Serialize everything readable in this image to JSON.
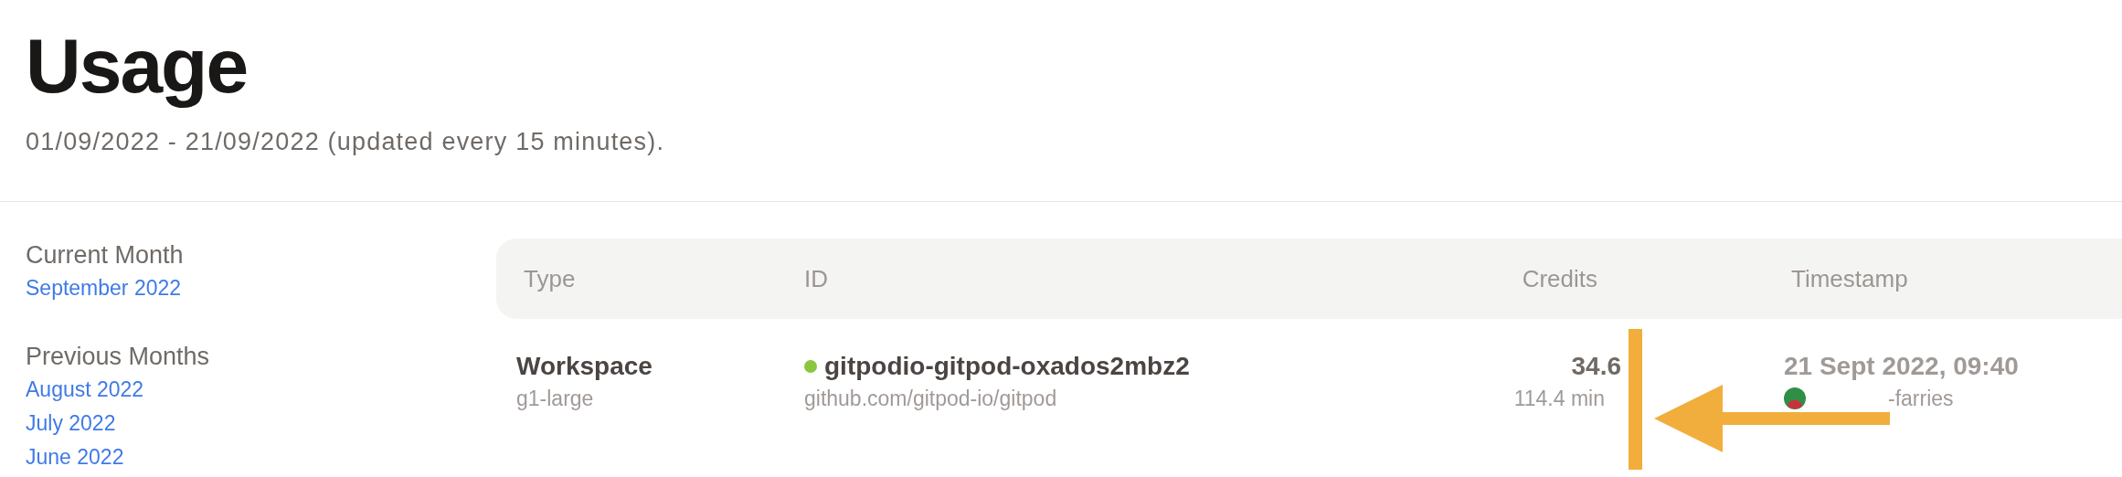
{
  "title": "Usage",
  "subtitle": "01/09/2022 - 21/09/2022 (updated every 15 minutes).",
  "sidebar": {
    "sections": [
      {
        "heading": "Current Month",
        "items": [
          {
            "label": "September 2022"
          }
        ]
      },
      {
        "heading": "Previous Months",
        "items": [
          {
            "label": "August 2022"
          },
          {
            "label": "July 2022"
          },
          {
            "label": "June 2022"
          }
        ]
      }
    ]
  },
  "table": {
    "columns": [
      "Type",
      "ID",
      "Credits",
      "Timestamp"
    ],
    "rows": [
      {
        "type": "Workspace",
        "class": "g1-large",
        "id": "gitpodio-gitpod-oxados2mbz2",
        "color": "#8cc63f",
        "repo": "github.com/gitpod-io/gitpod",
        "credits": "34.6",
        "duration": "114.4 min",
        "timestamp": "21 Sept 2022, 09:40",
        "user": "-farries"
      }
    ]
  }
}
